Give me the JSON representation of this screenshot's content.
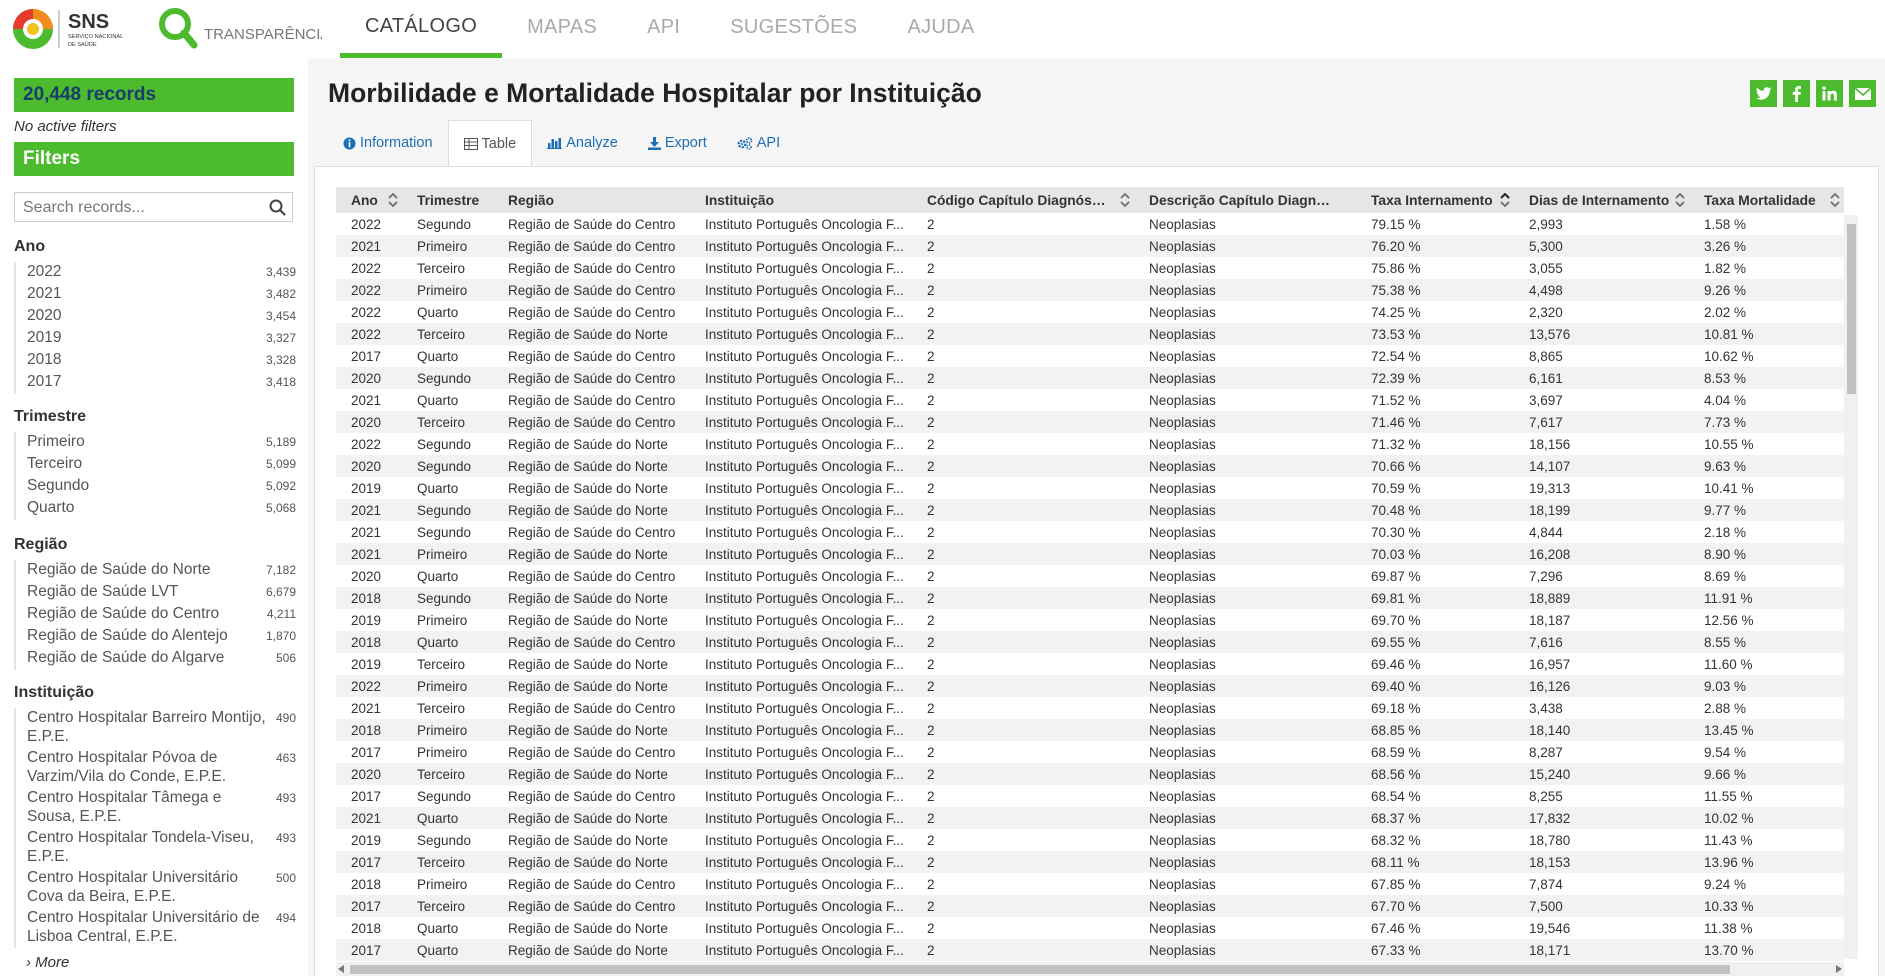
{
  "header": {
    "logo_text": "SNS",
    "logo_sub": "SERVIÇO NACIONAL DE SAÚDE",
    "brand_text": "TRANSPARÊNCIA",
    "nav": [
      "CATÁLOGO",
      "MAPAS",
      "API",
      "SUGESTÕES",
      "AJUDA"
    ],
    "active_nav": "CATÁLOGO"
  },
  "sidebar": {
    "records": "20,448 records",
    "no_filters": "No active filters",
    "filters_label": "Filters",
    "search_placeholder": "Search records...",
    "facets": [
      {
        "title": "Ano",
        "items": [
          {
            "label": "2022",
            "count": "3,439"
          },
          {
            "label": "2021",
            "count": "3,482"
          },
          {
            "label": "2020",
            "count": "3,454"
          },
          {
            "label": "2019",
            "count": "3,327"
          },
          {
            "label": "2018",
            "count": "3,328"
          },
          {
            "label": "2017",
            "count": "3,418"
          }
        ]
      },
      {
        "title": "Trimestre",
        "items": [
          {
            "label": "Primeiro",
            "count": "5,189"
          },
          {
            "label": "Terceiro",
            "count": "5,099"
          },
          {
            "label": "Segundo",
            "count": "5,092"
          },
          {
            "label": "Quarto",
            "count": "5,068"
          }
        ]
      },
      {
        "title": "Região",
        "items": [
          {
            "label": "Região de Saúde do Norte",
            "count": "7,182"
          },
          {
            "label": "Região de Saúde LVT",
            "count": "6,679"
          },
          {
            "label": "Região de Saúde do Centro",
            "count": "4,211"
          },
          {
            "label": "Região de Saúde do Alentejo",
            "count": "1,870"
          },
          {
            "label": "Região de Saúde do Algarve",
            "count": "506"
          }
        ]
      },
      {
        "title": "Instituição",
        "items": [
          {
            "label": "Centro Hospitalar Barreiro Montijo, E.P.E.",
            "count": "490"
          },
          {
            "label": "Centro Hospitalar Póvoa de Varzim/Vila do Conde, E.P.E.",
            "count": "463"
          },
          {
            "label": "Centro Hospitalar Tâmega e Sousa, E.P.E.",
            "count": "493"
          },
          {
            "label": "Centro Hospitalar Tondela-Viseu, E.P.E.",
            "count": "493"
          },
          {
            "label": "Centro Hospitalar Universitário Cova da Beira, E.P.E.",
            "count": "500"
          },
          {
            "label": "Centro Hospitalar Universitário de Lisboa Central, E.P.E.",
            "count": "494"
          }
        ]
      }
    ],
    "more_label": "› More"
  },
  "page": {
    "title": "Morbilidade e Mortalidade Hospitalar por Instituição",
    "tabs": [
      "Information",
      "Table",
      "Analyze",
      "Export",
      "API"
    ],
    "active_tab": "Table",
    "social_icons": [
      "twitter-icon",
      "facebook-icon",
      "linkedin-icon",
      "email-icon"
    ]
  },
  "table": {
    "columns": [
      "Ano",
      "Trimestre",
      "Região",
      "Instituição",
      "Código Capítulo Diagnóstico ...",
      "Descrição Capítulo Diagnóstic...",
      "Taxa Internamento",
      "Dias de Internamento",
      "Taxa Mortalidade"
    ],
    "rows": [
      [
        "2022",
        "Segundo",
        "Região de Saúde do Centro",
        "Instituto Português Oncologia F...",
        "2",
        "Neoplasias",
        "79.15 %",
        "2,993",
        "1.58 %"
      ],
      [
        "2021",
        "Primeiro",
        "Região de Saúde do Centro",
        "Instituto Português Oncologia F...",
        "2",
        "Neoplasias",
        "76.20 %",
        "5,300",
        "3.26 %"
      ],
      [
        "2022",
        "Terceiro",
        "Região de Saúde do Centro",
        "Instituto Português Oncologia F...",
        "2",
        "Neoplasias",
        "75.86 %",
        "3,055",
        "1.82 %"
      ],
      [
        "2022",
        "Primeiro",
        "Região de Saúde do Centro",
        "Instituto Português Oncologia F...",
        "2",
        "Neoplasias",
        "75.38 %",
        "4,498",
        "9.26 %"
      ],
      [
        "2022",
        "Quarto",
        "Região de Saúde do Centro",
        "Instituto Português Oncologia F...",
        "2",
        "Neoplasias",
        "74.25 %",
        "2,320",
        "2.02 %"
      ],
      [
        "2022",
        "Terceiro",
        "Região de Saúde do Norte",
        "Instituto Português Oncologia F...",
        "2",
        "Neoplasias",
        "73.53 %",
        "13,576",
        "10.81 %"
      ],
      [
        "2017",
        "Quarto",
        "Região de Saúde do Centro",
        "Instituto Português Oncologia F...",
        "2",
        "Neoplasias",
        "72.54 %",
        "8,865",
        "10.62 %"
      ],
      [
        "2020",
        "Segundo",
        "Região de Saúde do Centro",
        "Instituto Português Oncologia F...",
        "2",
        "Neoplasias",
        "72.39 %",
        "6,161",
        "8.53 %"
      ],
      [
        "2021",
        "Quarto",
        "Região de Saúde do Centro",
        "Instituto Português Oncologia F...",
        "2",
        "Neoplasias",
        "71.52 %",
        "3,697",
        "4.04 %"
      ],
      [
        "2020",
        "Terceiro",
        "Região de Saúde do Centro",
        "Instituto Português Oncologia F...",
        "2",
        "Neoplasias",
        "71.46 %",
        "7,617",
        "7.73 %"
      ],
      [
        "2022",
        "Segundo",
        "Região de Saúde do Norte",
        "Instituto Português Oncologia F...",
        "2",
        "Neoplasias",
        "71.32 %",
        "18,156",
        "10.55 %"
      ],
      [
        "2020",
        "Segundo",
        "Região de Saúde do Norte",
        "Instituto Português Oncologia F...",
        "2",
        "Neoplasias",
        "70.66 %",
        "14,107",
        "9.63 %"
      ],
      [
        "2019",
        "Quarto",
        "Região de Saúde do Norte",
        "Instituto Português Oncologia F...",
        "2",
        "Neoplasias",
        "70.59 %",
        "19,313",
        "10.41 %"
      ],
      [
        "2021",
        "Segundo",
        "Região de Saúde do Norte",
        "Instituto Português Oncologia F...",
        "2",
        "Neoplasias",
        "70.48 %",
        "18,199",
        "9.77 %"
      ],
      [
        "2021",
        "Segundo",
        "Região de Saúde do Centro",
        "Instituto Português Oncologia F...",
        "2",
        "Neoplasias",
        "70.30 %",
        "4,844",
        "2.18 %"
      ],
      [
        "2021",
        "Primeiro",
        "Região de Saúde do Norte",
        "Instituto Português Oncologia F...",
        "2",
        "Neoplasias",
        "70.03 %",
        "16,208",
        "8.90 %"
      ],
      [
        "2020",
        "Quarto",
        "Região de Saúde do Centro",
        "Instituto Português Oncologia F...",
        "2",
        "Neoplasias",
        "69.87 %",
        "7,296",
        "8.69 %"
      ],
      [
        "2018",
        "Segundo",
        "Região de Saúde do Norte",
        "Instituto Português Oncologia F...",
        "2",
        "Neoplasias",
        "69.81 %",
        "18,889",
        "11.91 %"
      ],
      [
        "2019",
        "Primeiro",
        "Região de Saúde do Norte",
        "Instituto Português Oncologia F...",
        "2",
        "Neoplasias",
        "69.70 %",
        "18,187",
        "12.56 %"
      ],
      [
        "2018",
        "Quarto",
        "Região de Saúde do Centro",
        "Instituto Português Oncologia F...",
        "2",
        "Neoplasias",
        "69.55 %",
        "7,616",
        "8.55 %"
      ],
      [
        "2019",
        "Terceiro",
        "Região de Saúde do Norte",
        "Instituto Português Oncologia F...",
        "2",
        "Neoplasias",
        "69.46 %",
        "16,957",
        "11.60 %"
      ],
      [
        "2022",
        "Primeiro",
        "Região de Saúde do Norte",
        "Instituto Português Oncologia F...",
        "2",
        "Neoplasias",
        "69.40 %",
        "16,126",
        "9.03 %"
      ],
      [
        "2021",
        "Terceiro",
        "Região de Saúde do Centro",
        "Instituto Português Oncologia F...",
        "2",
        "Neoplasias",
        "69.18 %",
        "3,438",
        "2.88 %"
      ],
      [
        "2018",
        "Primeiro",
        "Região de Saúde do Norte",
        "Instituto Português Oncologia F...",
        "2",
        "Neoplasias",
        "68.85 %",
        "18,140",
        "13.45 %"
      ],
      [
        "2017",
        "Primeiro",
        "Região de Saúde do Centro",
        "Instituto Português Oncologia F...",
        "2",
        "Neoplasias",
        "68.59 %",
        "8,287",
        "9.54 %"
      ],
      [
        "2020",
        "Terceiro",
        "Região de Saúde do Norte",
        "Instituto Português Oncologia F...",
        "2",
        "Neoplasias",
        "68.56 %",
        "15,240",
        "9.66 %"
      ],
      [
        "2017",
        "Segundo",
        "Região de Saúde do Centro",
        "Instituto Português Oncologia F...",
        "2",
        "Neoplasias",
        "68.54 %",
        "8,255",
        "11.55 %"
      ],
      [
        "2021",
        "Quarto",
        "Região de Saúde do Norte",
        "Instituto Português Oncologia F...",
        "2",
        "Neoplasias",
        "68.37 %",
        "17,832",
        "10.02 %"
      ],
      [
        "2019",
        "Segundo",
        "Região de Saúde do Norte",
        "Instituto Português Oncologia F...",
        "2",
        "Neoplasias",
        "68.32 %",
        "18,780",
        "11.43 %"
      ],
      [
        "2017",
        "Terceiro",
        "Região de Saúde do Norte",
        "Instituto Português Oncologia F...",
        "2",
        "Neoplasias",
        "68.11 %",
        "18,153",
        "13.96 %"
      ],
      [
        "2018",
        "Primeiro",
        "Região de Saúde do Centro",
        "Instituto Português Oncologia F...",
        "2",
        "Neoplasias",
        "67.85 %",
        "7,874",
        "9.24 %"
      ],
      [
        "2017",
        "Terceiro",
        "Região de Saúde do Centro",
        "Instituto Português Oncologia F...",
        "2",
        "Neoplasias",
        "67.70 %",
        "7,500",
        "10.33 %"
      ],
      [
        "2018",
        "Quarto",
        "Região de Saúde do Norte",
        "Instituto Português Oncologia F...",
        "2",
        "Neoplasias",
        "67.46 %",
        "19,546",
        "11.38 %"
      ],
      [
        "2017",
        "Quarto",
        "Região de Saúde do Norte",
        "Instituto Português Oncologia F...",
        "2",
        "Neoplasias",
        "67.33 %",
        "18,171",
        "13.70 %"
      ]
    ]
  },
  "colors": {
    "accent": "#4cbb2e",
    "link": "#1f6fb5",
    "records_text": "#1a3d6b"
  }
}
